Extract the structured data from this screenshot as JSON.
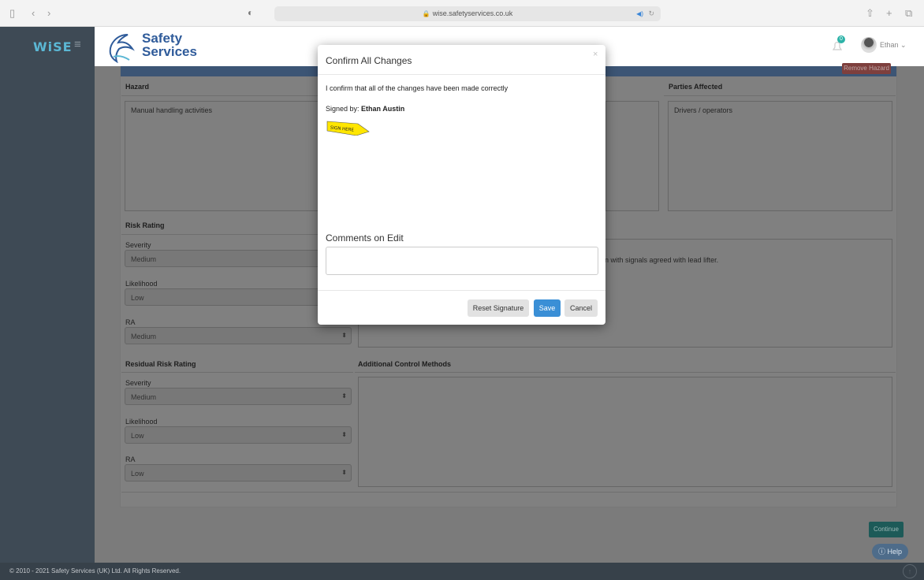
{
  "browser": {
    "url": "wise.safetyservices.co.uk"
  },
  "header": {
    "logo": "WiSE",
    "brand_line1": "Safety",
    "brand_line2": "Services",
    "notification_count": "0",
    "user_name": "Ethan"
  },
  "form": {
    "remove_hazard": "Remove Hazard",
    "hazard_label": "Hazard",
    "hazard_value": "Manual handling activities",
    "parties_label": "Parties Affected",
    "parties_value": "Drivers / operators",
    "risk_rating_label": "Risk Rating",
    "severity_label": "Severity",
    "severity_value": "Medium",
    "likelihood_label": "Likelihood",
    "likelihood_value": "Low",
    "ra_label": "RA",
    "ra_value": "Medium",
    "control_partial": "n with signals agreed with lead lifter.",
    "residual_label": "Residual Risk Rating",
    "res_severity_label": "Severity",
    "res_severity_value": "Medium",
    "res_likelihood_label": "Likelihood",
    "res_likelihood_value": "Low",
    "res_ra_label": "RA",
    "res_ra_value": "Low",
    "additional_label": "Additional Control Methods"
  },
  "buttons": {
    "continue": "Continue",
    "help": "Help"
  },
  "footer": {
    "copyright": "© 2010 - 2021 Safety Services (UK) Ltd. All Rights Reserved."
  },
  "modal": {
    "title": "Confirm All Changes",
    "close": "×",
    "confirm_text": "I confirm that all of the changes have been made correctly",
    "signed_by_prefix": "Signed by:",
    "signed_by_name": "Ethan Austin",
    "sign_here": "SIGN HERE",
    "comments_label": "Comments on Edit",
    "reset_signature": "Reset Signature",
    "save": "Save",
    "cancel": "Cancel"
  },
  "colors": {
    "accent_blue": "#3a8fd6",
    "sidebar": "#3e4a55",
    "brand": "#2f5b9a",
    "teal": "#2db3a8",
    "sign_here_yellow": "#ffe600"
  },
  "icons": {
    "sidebar_toggle": "sidebar-toggle-icon",
    "back": "chevron-left-icon",
    "forward": "chevron-right-icon",
    "shield": "shield-icon",
    "lock": "lock-icon",
    "reload": "reload-icon",
    "share": "share-icon",
    "new_tab": "plus-icon",
    "tabs": "tabs-icon",
    "menu": "hamburger-icon",
    "notification": "bell-icon",
    "help": "help-icon",
    "scroll_top": "arrow-up-icon"
  }
}
